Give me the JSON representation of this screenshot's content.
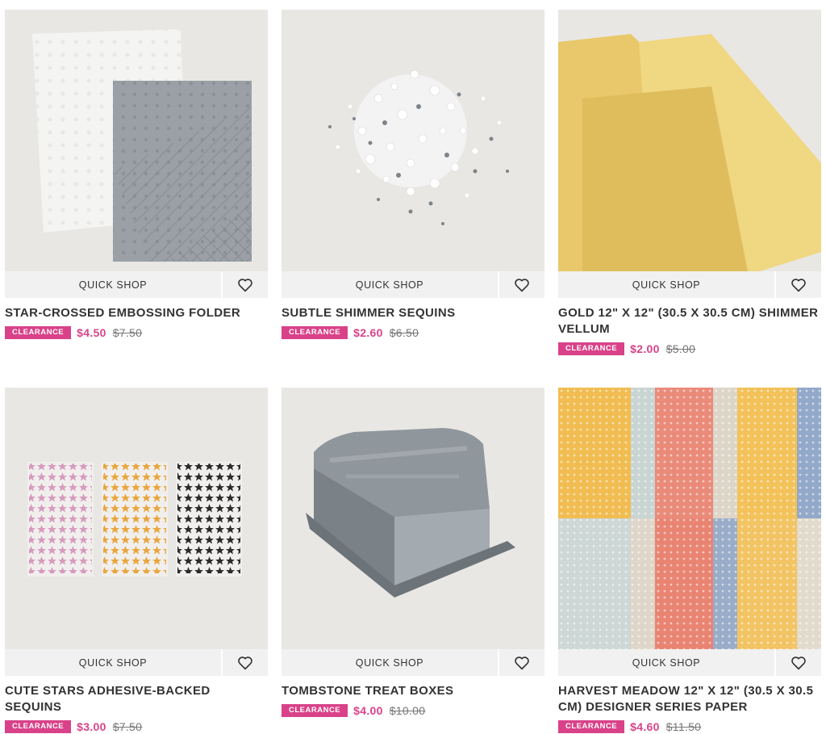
{
  "products": [
    {
      "quick_shop": "QUICK SHOP",
      "title": "STAR-CROSSED EMBOSSING FOLDER",
      "badge": "CLEARANCE",
      "price": "$4.50",
      "old_price": "$7.50"
    },
    {
      "quick_shop": "QUICK SHOP",
      "title": "SUBTLE SHIMMER SEQUINS",
      "badge": "CLEARANCE",
      "price": "$2.60",
      "old_price": "$6.50"
    },
    {
      "quick_shop": "QUICK SHOP",
      "title": "GOLD 12\" X 12\" (30.5 X 30.5 CM) SHIMMER VELLUM",
      "badge": "CLEARANCE",
      "price": "$2.00",
      "old_price": "$5.00"
    },
    {
      "quick_shop": "QUICK SHOP",
      "title": "CUTE STARS ADHESIVE-BACKED SEQUINS",
      "badge": "CLEARANCE",
      "price": "$3.00",
      "old_price": "$7.50"
    },
    {
      "quick_shop": "QUICK SHOP",
      "title": "TOMBSTONE TREAT BOXES",
      "badge": "CLEARANCE",
      "price": "$4.00",
      "old_price": "$10.00"
    },
    {
      "quick_shop": "QUICK SHOP",
      "title": "HARVEST MEADOW 12\" X 12\" (30.5 X 30.5 CM) DESIGNER SERIES PAPER",
      "badge": "CLEARANCE",
      "price": "$4.60",
      "old_price": "$11.50"
    }
  ],
  "icons": {
    "wishlist": "heart-outline-icon"
  },
  "colors": {
    "accent": "#d94289",
    "bar_bg": "#f1f1f1",
    "text": "#333333"
  }
}
